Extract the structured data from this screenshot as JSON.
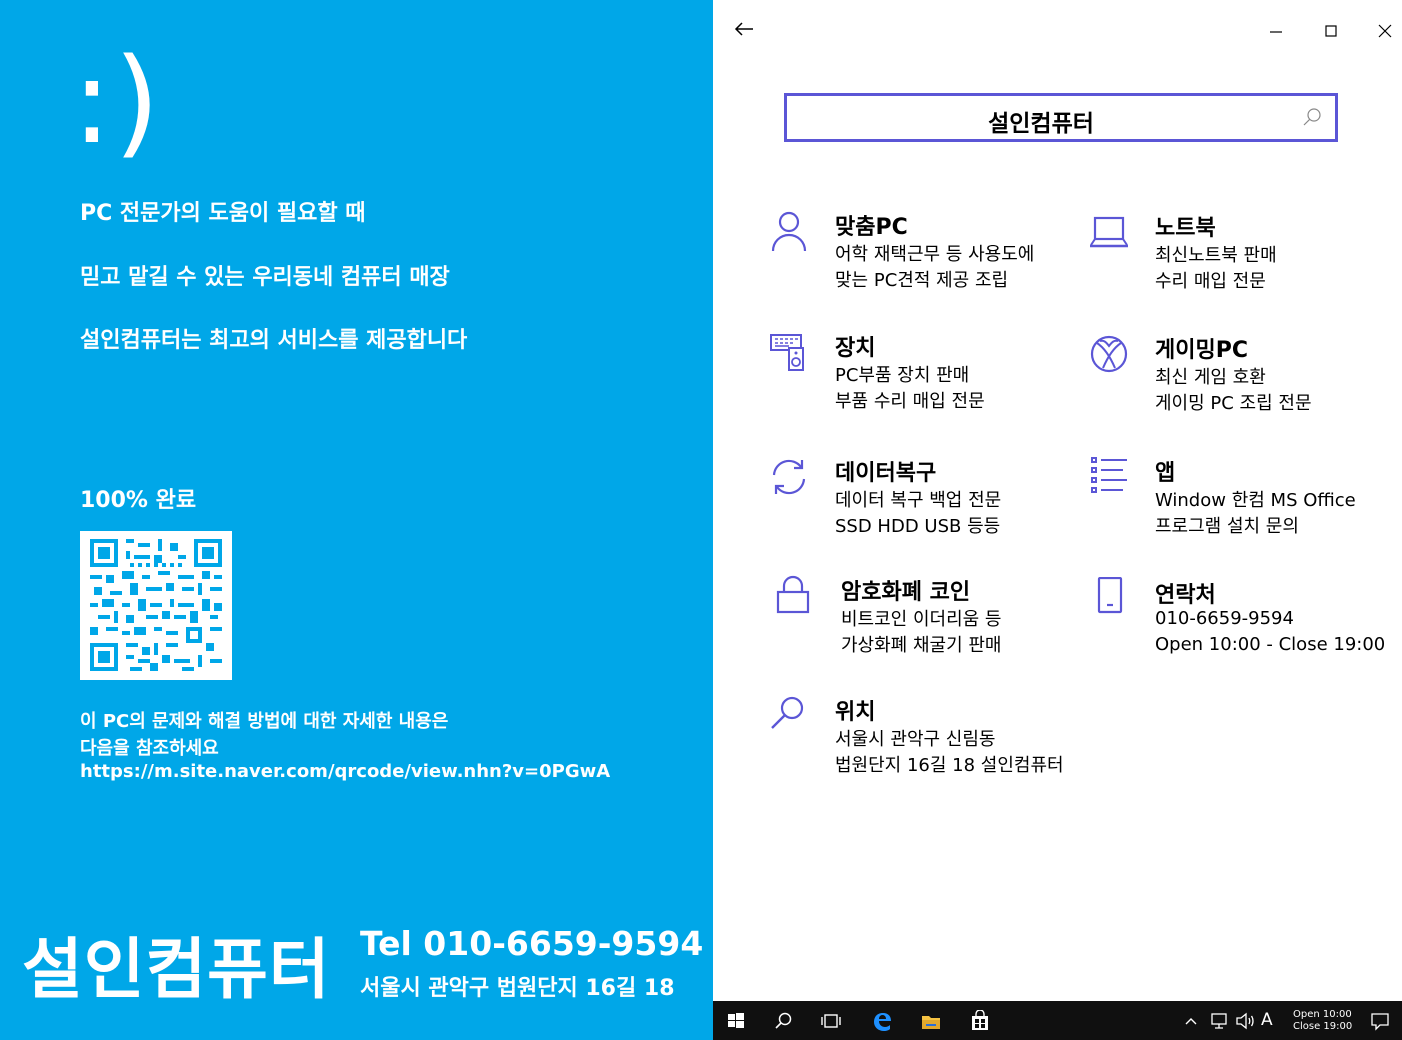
{
  "left": {
    "smiley": ":)",
    "messages": [
      "PC 전문가의 도움이 필요할 때",
      "믿고 맡길 수 있는 우리동네 컴퓨터 매장",
      "설인컴퓨터는 최고의 서비스를 제공합니다"
    ],
    "progress": "100% 완료",
    "note_lines": [
      "이 PC의 문제와 해결 방법에 대한 자세한 내용은",
      "다음을 참조하세요",
      "https://m.site.naver.com/qrcode/view.nhn?v=0PGwA"
    ],
    "brand": "설인컴퓨터",
    "tel": "Tel 010-6659-9594",
    "address": "서울시 관악구 법원단지 16길 18"
  },
  "window": {
    "search_value": "설인컴퓨터"
  },
  "items": [
    {
      "icon": "person-icon",
      "title": "맞춤PC",
      "line1": "어학 재택근무 등 사용도에",
      "line2": "맞는 PC견적 제공 조립"
    },
    {
      "icon": "laptop-icon",
      "title": "노트북",
      "line1": "최신노트북 판매",
      "line2": "수리 매입 전문"
    },
    {
      "icon": "devices-icon",
      "title": "장치",
      "line1": "PC부품 장치 판매",
      "line2": "부품 수리 매입 전문"
    },
    {
      "icon": "xbox-icon",
      "title": "게이밍PC",
      "line1": "최신 게임 호환",
      "line2": "게이밍 PC 조립 전문"
    },
    {
      "icon": "sync-icon",
      "title": "데이터복구",
      "line1": "데이터 복구 백업 전문",
      "line2": "SSD HDD USB 등등"
    },
    {
      "icon": "apps-list-icon",
      "title": "앱",
      "line1": "Window 한컴 MS Office",
      "line2": "프로그램 설치 문의"
    },
    {
      "icon": "lock-icon",
      "title": "암호화폐 코인",
      "line1": "비트코인 이더리움 등",
      "line2": "가상화폐 채굴기 판매"
    },
    {
      "icon": "phone-icon",
      "title": "연락처",
      "line1": "010-6659-9594",
      "line2": "Open 10:00 - Close 19:00"
    },
    {
      "icon": "search-icon",
      "title": "위치",
      "line1": "서울시 관악구 신림동",
      "line2": "법원단지 16길 18 설인컴퓨터"
    }
  ],
  "taskbar": {
    "tray_lang": "A",
    "clock_line1": "Open 10:00",
    "clock_line2": "Close 19:00"
  },
  "colors": {
    "left_bg": "#00a7e8",
    "accent": "#5b56d6",
    "taskbar": "#101010"
  }
}
